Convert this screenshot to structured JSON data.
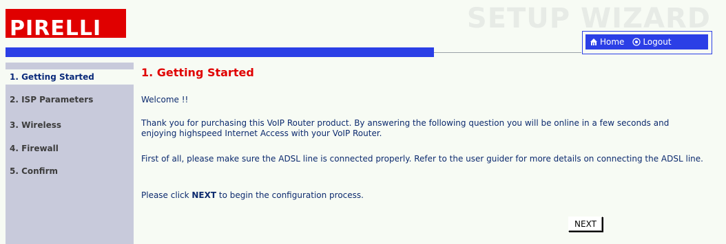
{
  "header": {
    "brand": "PIRELLI",
    "wizard_title": "SETUP WIZARD",
    "nav": {
      "home": "Home",
      "logout": "Logout"
    }
  },
  "sidebar": {
    "items": [
      {
        "label": "1. Getting Started",
        "active": true
      },
      {
        "label": "2. ISP Parameters",
        "active": false
      },
      {
        "label": "3. Wireless",
        "active": false
      },
      {
        "label": "4. Firewall",
        "active": false
      },
      {
        "label": "5. Confirm",
        "active": false
      }
    ]
  },
  "main": {
    "title": "1. Getting Started",
    "welcome": "Welcome !!",
    "thanks": "Thank you for purchasing this VoIP Router product. By answering the following question you will be online in a few seconds and enjoying highspeed Internet Access with your VoIP Router.",
    "adsl": "First of all, please make sure the ADSL line is connected properly. Refer to the user guider for more details on connecting the ADSL line.",
    "click_prefix": "Please click ",
    "click_next": "NEXT",
    "click_suffix": " to begin the configuration process.",
    "next_button": "NEXT"
  },
  "colors": {
    "brand_red": "#e00000",
    "nav_blue": "#2b3fe6",
    "sidebar_bg": "#c8cadb",
    "text_blue": "#0c2a6e"
  }
}
